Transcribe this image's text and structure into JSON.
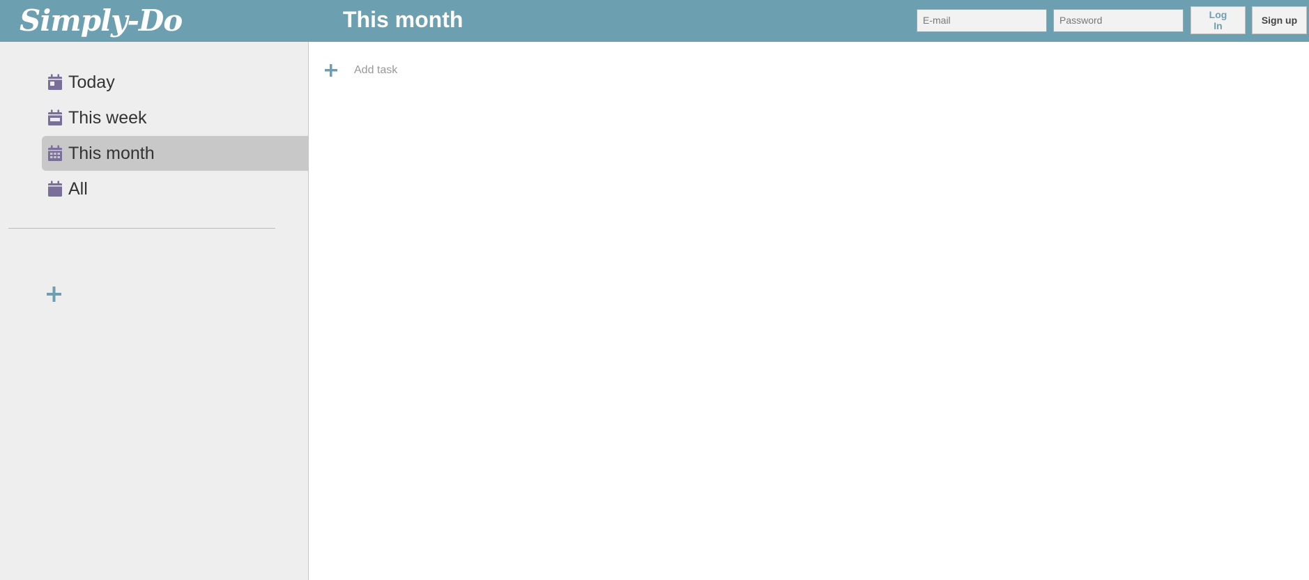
{
  "header": {
    "logo": "Simply-Do",
    "page_title": "This month",
    "email_placeholder": "E-mail",
    "password_placeholder": "Password",
    "login_label": "Log In",
    "signup_label": "Sign up"
  },
  "sidebar": {
    "items": [
      {
        "label": "Today",
        "icon": "calendar-day-icon"
      },
      {
        "label": "This week",
        "icon": "calendar-week-icon"
      },
      {
        "label": "This month",
        "icon": "calendar-month-icon",
        "active": true
      },
      {
        "label": "All",
        "icon": "calendar-icon"
      }
    ],
    "add_list_icon": "plus-icon"
  },
  "main": {
    "add_task_label": "Add task",
    "add_task_icon": "plus-icon"
  },
  "colors": {
    "header_bg": "#6c9fb0",
    "accent": "#6c9fb0",
    "icon_purple": "#7a6f9b",
    "sidebar_bg": "#eeeeee",
    "active_bg": "#c8c8c8"
  }
}
